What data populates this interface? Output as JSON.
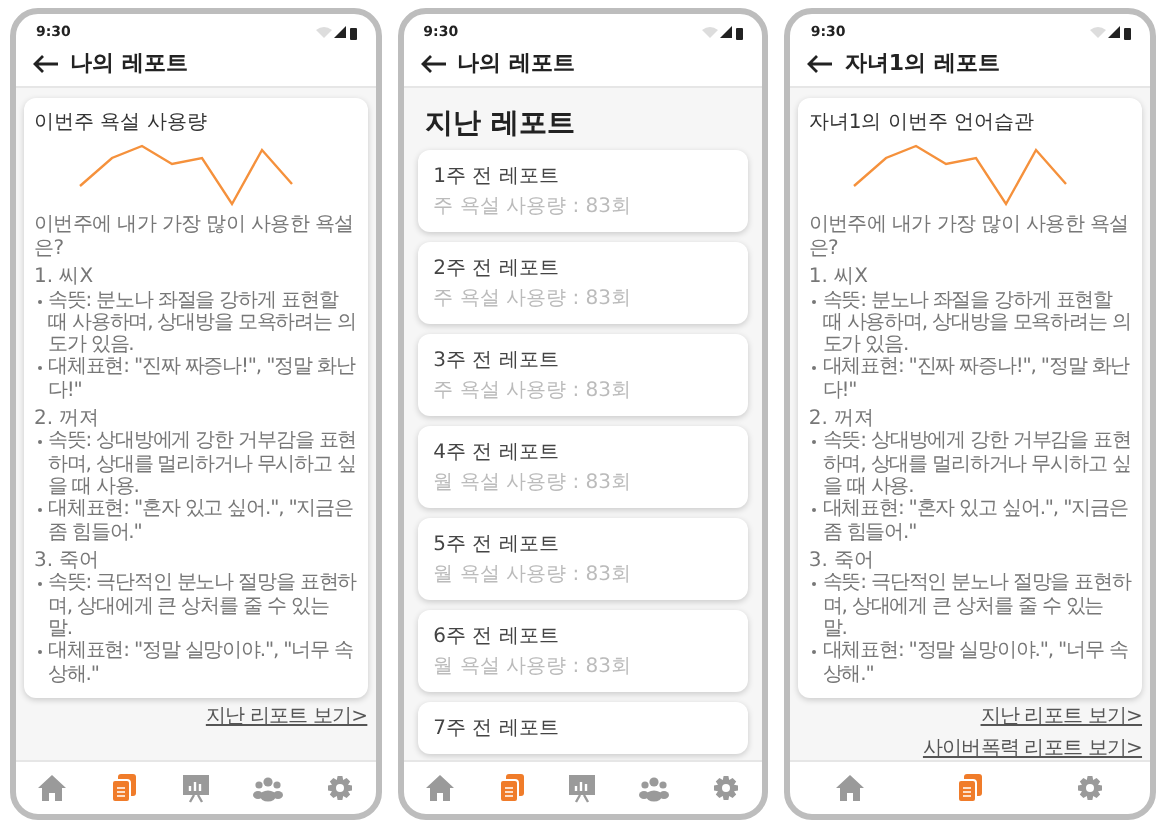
{
  "screens": [
    {
      "kind": "report",
      "time": "9:30",
      "title": "나의 레포트",
      "card": {
        "title": "이번주 욕설 사용량",
        "question": "이번주에 내가 가장 많이 사용한 욕설은?",
        "items": [
          {
            "heading": "1. 씨X",
            "bullets": [
              "속뜻: 분노나 좌절을 강하게 표현할 때 사용하며, 상대방을 모욕하려는 의도가 있음.",
              "대체표현: \"진짜 짜증나!\", \"정말 화난다!\""
            ]
          },
          {
            "heading": "2. 꺼져",
            "bullets": [
              "속뜻: 상대방에게 강한 거부감을 표현하며, 상대를 멀리하거나 무시하고 싶을 때 사용.",
              "대체표현: \"혼자 있고 싶어.\", \"지금은 좀 힘들어.\""
            ]
          },
          {
            "heading": "3. 죽어",
            "bullets": [
              "속뜻: 극단적인 분노나 절망을 표현하며, 상대에게 큰 상처를 줄 수 있는 말.",
              "대체표현: \"정말 실망이야.\", \"너무 속상해.\""
            ]
          }
        ]
      },
      "links": [
        "지난 리포트 보기>"
      ],
      "nav": [
        {
          "kind": "home",
          "selected": false
        },
        {
          "kind": "report",
          "selected": true
        },
        {
          "kind": "board",
          "selected": false
        },
        {
          "kind": "group",
          "selected": false
        },
        {
          "kind": "settings",
          "selected": false
        }
      ]
    },
    {
      "kind": "list",
      "time": "9:30",
      "title": "나의 레포트",
      "heading": "지난 레포트",
      "reports": [
        {
          "title": "1주 전 레포트",
          "subtitle": "주 욕설 사용량 : 83회"
        },
        {
          "title": "2주 전 레포트",
          "subtitle": "주 욕설 사용량 : 83회"
        },
        {
          "title": "3주 전 레포트",
          "subtitle": "주 욕설 사용량 : 83회"
        },
        {
          "title": "4주 전 레포트",
          "subtitle": "월 욕설 사용량 : 83회"
        },
        {
          "title": "5주 전 레포트",
          "subtitle": "월 욕설 사용량 : 83회"
        },
        {
          "title": "6주 전 레포트",
          "subtitle": "월 욕설 사용량 : 83회"
        },
        {
          "title": "7주 전 레포트"
        }
      ],
      "nav": [
        {
          "kind": "home",
          "selected": false
        },
        {
          "kind": "report",
          "selected": true
        },
        {
          "kind": "board",
          "selected": false
        },
        {
          "kind": "group",
          "selected": false
        },
        {
          "kind": "settings",
          "selected": false
        }
      ]
    },
    {
      "kind": "report",
      "time": "9:30",
      "title": "자녀1의 레포트",
      "card": {
        "title": "자녀1의 이번주 언어습관",
        "question": "이번주에 내가 가장 많이 사용한 욕설은?",
        "items": [
          {
            "heading": "1. 씨X",
            "bullets": [
              "속뜻: 분노나 좌절을 강하게 표현할 때 사용하며, 상대방을 모욕하려는 의도가 있음.",
              "대체표현: \"진짜 짜증나!\", \"정말 화난다!\""
            ]
          },
          {
            "heading": "2. 꺼져",
            "bullets": [
              "속뜻: 상대방에게 강한 거부감을 표현하며, 상대를 멀리하거나 무시하고 싶을 때 사용.",
              "대체표현: \"혼자 있고 싶어.\", \"지금은 좀 힘들어.\""
            ]
          },
          {
            "heading": "3. 죽어",
            "bullets": [
              "속뜻: 극단적인 분노나 절망을 표현하며, 상대에게 큰 상처를 줄 수 있는 말.",
              "대체표현: \"정말 실망이야.\", \"너무 속상해.\""
            ]
          }
        ]
      },
      "links": [
        "지난 리포트 보기>",
        "사이버폭력 리포트 보기>"
      ],
      "nav": [
        {
          "kind": "home",
          "selected": false
        },
        {
          "kind": "report",
          "selected": true
        },
        {
          "kind": "settings",
          "selected": false
        }
      ]
    }
  ]
}
